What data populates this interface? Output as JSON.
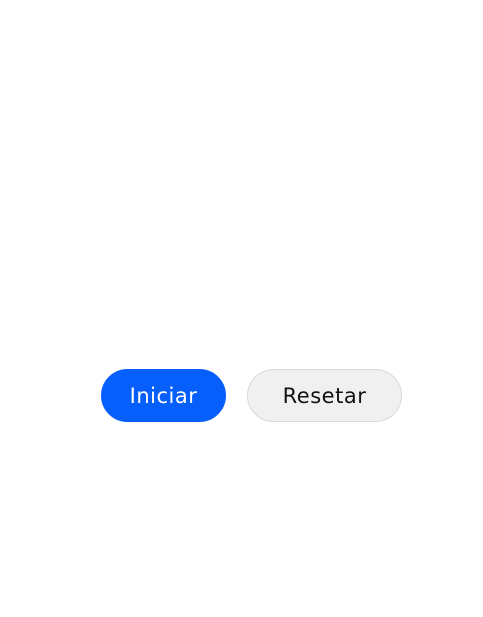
{
  "controls": {
    "start_label": "Iniciar",
    "reset_label": "Resetar"
  },
  "colors": {
    "primary": "#075ffb",
    "secondary_bg": "#f0f0f0",
    "background": "#ffffff"
  }
}
